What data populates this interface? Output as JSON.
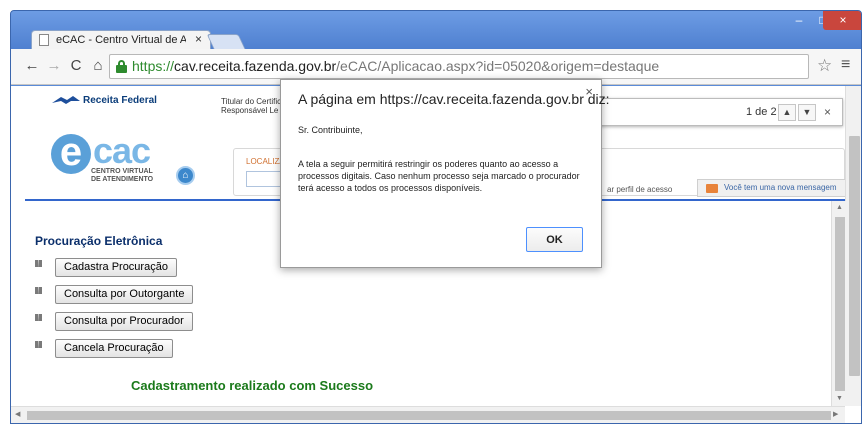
{
  "browser": {
    "tab_title": "eCAC - Centro Virtual de A",
    "tab_close": "×",
    "window_minimize": "–",
    "window_maximize": "□",
    "window_close": "×",
    "nav": {
      "back": "←",
      "forward": "→",
      "reload": "C",
      "home": "⌂"
    },
    "url_scheme": "https://",
    "url_host": "cav.receita.fazenda.gov.br",
    "url_path": "/eCAC/Aplicacao.aspx?id=05020&origem=destaque",
    "star": "☆",
    "menu": "≡"
  },
  "find_bar": {
    "count": "1 de 2",
    "up": "▲",
    "down": "▼",
    "close": "×"
  },
  "header": {
    "receita_logo": "Receita Federal",
    "titular_line1": "Titular do Certific",
    "titular_line2": "Responsável Le",
    "ecac_e": "e",
    "ecac_cac": "cac",
    "ecac_sub1": "CENTRO VIRTUAL",
    "ecac_sub2": "DE ATENDIMENTO",
    "localizar": "LOCALIZAR",
    "perfil": "ar perfil de acesso",
    "mensagem": "Você tem uma nova mensagem"
  },
  "content": {
    "section_title": "Procuração Eletrônica",
    "actions": [
      {
        "label": "Cadastra Procuração"
      },
      {
        "label": "Consulta por Outorgante"
      },
      {
        "label": "Consulta por Procurador"
      },
      {
        "label": "Cancela Procuração"
      }
    ],
    "success": "Cadastramento realizado com Sucesso"
  },
  "dialog": {
    "title": "A página em https://cav.receita.fazenda.gov.br diz:",
    "close": "×",
    "greeting": "Sr. Contribuinte,",
    "message": "A tela a seguir permitirá restringir os poderes quanto ao acesso a processos digitais. Caso nenhum processo seja marcado o procurador terá acesso a todos os processos disponíveis.",
    "ok": "OK"
  },
  "colors": {
    "browser_frame": "#5a8bd8",
    "secure_green": "#2e8b2e",
    "section_title": "#0b2f6b",
    "success_text": "#1b7a1b",
    "close_button": "#c9463d"
  }
}
